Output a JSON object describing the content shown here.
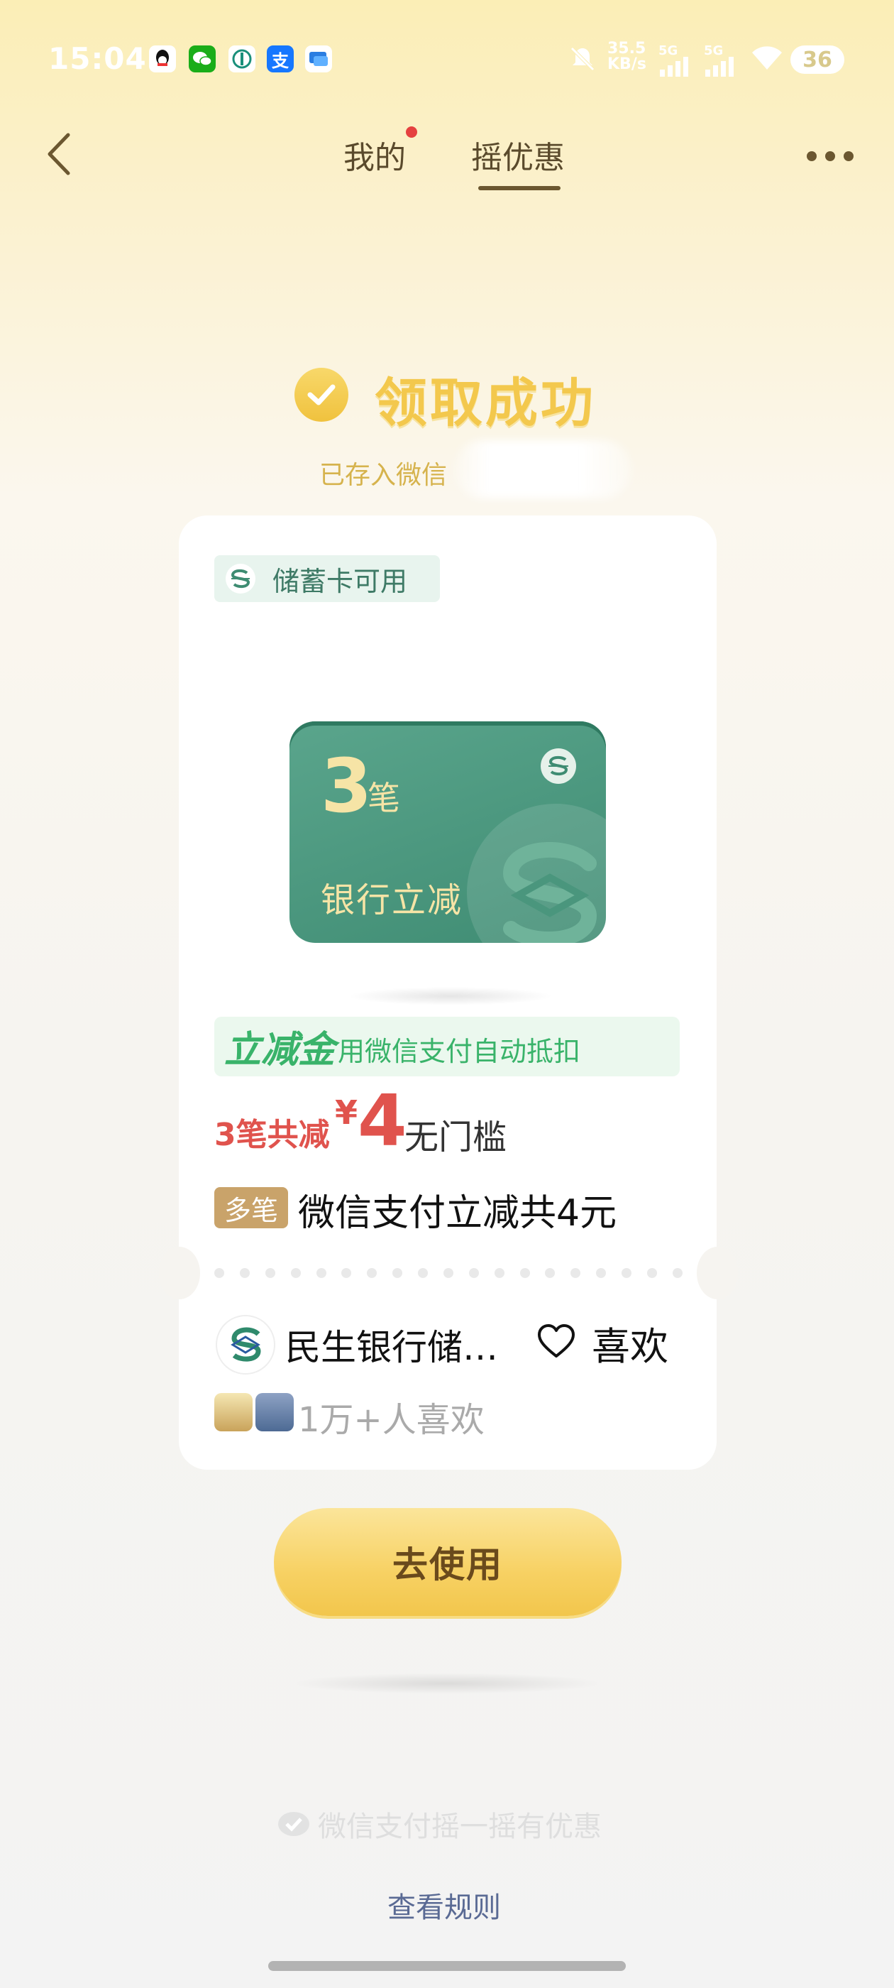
{
  "status_bar": {
    "time": "15:04",
    "network_speed": "35.5\nKB/s",
    "signal1": "5G",
    "signal2": "5G",
    "battery": "36"
  },
  "nav": {
    "tab_mine": "我的",
    "tab_shake": "摇优惠",
    "active_tab": "摇优惠"
  },
  "success": {
    "title": "领取成功",
    "stored_text": "已存入微信"
  },
  "card": {
    "badge_label": "储蓄卡可用",
    "image": {
      "number": "3",
      "unit": "笔",
      "label": "银行立减"
    },
    "lijian": {
      "title": "立减金",
      "desc": "用微信支付自动抵扣"
    },
    "discount": {
      "prefix": "3笔共减",
      "currency": "¥",
      "amount": "4",
      "suffix": "无门槛"
    },
    "multi": {
      "badge": "多笔",
      "desc": "微信支付立减共4元"
    },
    "bank_name": "民生银行储…",
    "like_label": "喜欢",
    "likes_count": "1万+人喜欢"
  },
  "use_button": "去使用",
  "footer": {
    "brand": "微信支付摇一摇有优惠",
    "rules": "查看规则"
  },
  "colors": {
    "accent_gold": "#f3c84d",
    "card_green": "#3f8c73",
    "discount_red": "#e0534d",
    "lijian_green": "#39b36a"
  }
}
